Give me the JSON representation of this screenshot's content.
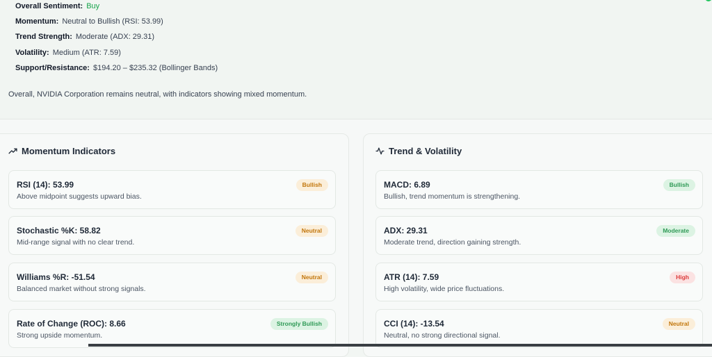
{
  "summary": {
    "lines": [
      {
        "key": "Overall Sentiment:",
        "value": "Buy"
      },
      {
        "key": "Momentum:",
        "value": "Neutral to Bullish (RSI: 53.99)"
      },
      {
        "key": "Trend Strength:",
        "value": "Moderate (ADX: 29.31)"
      },
      {
        "key": "Volatility:",
        "value": "Medium (ATR: 7.59)"
      },
      {
        "key": "Support/Resistance:",
        "value": "$194.20 – $235.32 (Bollinger Bands)"
      }
    ],
    "overall": "Overall, NVIDIA Corporation remains neutral, with indicators showing mixed momentum."
  },
  "momentum": {
    "title": "Momentum Indicators",
    "icon": "trending-up-icon",
    "cards": [
      {
        "title": "RSI (14): 53.99",
        "desc": "Above midpoint suggests upward bias.",
        "badge": "Bullish"
      },
      {
        "title": "Stochastic %K: 58.82",
        "desc": "Mid-range signal with no clear trend.",
        "badge": "Neutral"
      },
      {
        "title": "Williams %R: -51.54",
        "desc": "Balanced market without strong signals.",
        "badge": "Neutral"
      },
      {
        "title": "Rate of Change (ROC): 8.66",
        "desc": "Strong upside momentum.",
        "badge": "Strongly Bullish"
      }
    ]
  },
  "trend": {
    "title": "Trend & Volatility",
    "icon": "activity-icon",
    "cards": [
      {
        "title": "MACD: 6.89",
        "desc": "Bullish, trend momentum is strengthening.",
        "badge": "Bullish"
      },
      {
        "title": "ADX: 29.31",
        "desc": "Moderate trend, direction gaining strength.",
        "badge": "Moderate"
      },
      {
        "title": "ATR (14): 7.59",
        "desc": "High volatility, wide price fluctuations.",
        "badge": "High"
      },
      {
        "title": "CCI (14): -13.54",
        "desc": "Neutral, no strong directional signal.",
        "badge": "Neutral"
      }
    ]
  },
  "colors": {
    "buy": "#16a34a",
    "amber_badge_bg": "#fbeed9",
    "amber_badge_text": "#c2760b",
    "green_badge_bg": "#dcf3e3",
    "green_badge_text": "#2f9a56",
    "red_badge_bg": "#fbe2e2",
    "red_badge_text": "#dc3b3b"
  }
}
